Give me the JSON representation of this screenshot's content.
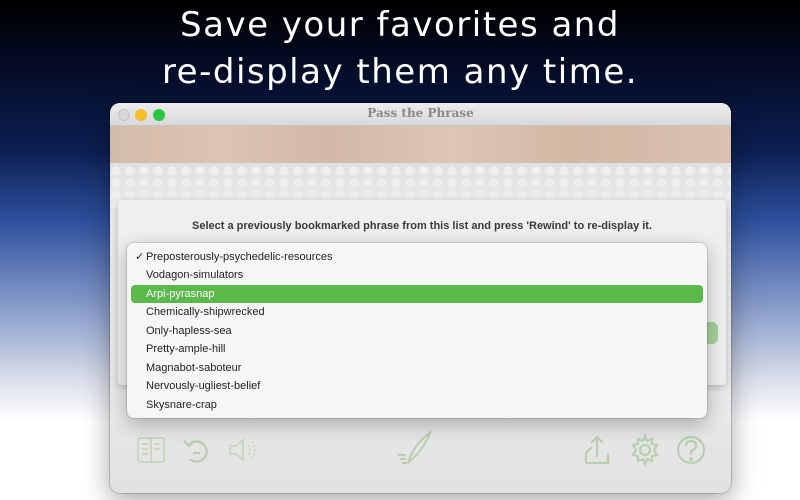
{
  "headline": {
    "line1": "Save your favorites and",
    "line2": "re-display them any time."
  },
  "window": {
    "title": "Pass the Phrase"
  },
  "dialog": {
    "instruction": "Select a previously bookmarked phrase from this list and press 'Rewind' to re-display it."
  },
  "menu": {
    "checkmark": "✓",
    "items": [
      "Preposterously-psychedelic-resources",
      "Vodagon-simulators",
      "Arpi-pyrasnap",
      "Chemically-shipwrecked",
      "Only-hapless-sea",
      "Pretty-ample-hill",
      "Magnabot-saboteur",
      "Nervously-ugliest-belief",
      "Skysnare-crap"
    ],
    "checked_index": 0,
    "highlighted_index": 2
  },
  "toolbar": {
    "icons": [
      "bookmarks-icon",
      "rewind-icon",
      "speaker-icon",
      "quill-icon",
      "share-icon",
      "gear-icon",
      "help-icon"
    ]
  },
  "colors": {
    "accent_green": "#5bb84a",
    "icon_green": "#7fae6a"
  }
}
